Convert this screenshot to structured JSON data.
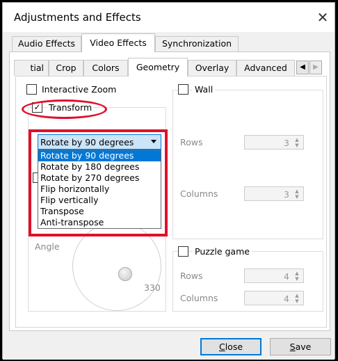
{
  "window": {
    "title": "Adjustments and Effects",
    "close_glyph": "✕"
  },
  "top_tabs": [
    {
      "label": "Audio Effects"
    },
    {
      "label": "Video Effects"
    },
    {
      "label": "Synchronization"
    }
  ],
  "sub_tabs": [
    {
      "label": "tial"
    },
    {
      "label": "Crop"
    },
    {
      "label": "Colors"
    },
    {
      "label": "Geometry"
    },
    {
      "label": "Overlay"
    },
    {
      "label": "Advanced"
    }
  ],
  "geometry": {
    "interactive_zoom": {
      "label": "Interactive Zoom",
      "checked": false
    },
    "transform": {
      "label": "Transform",
      "checked": true,
      "check_glyph": "✓"
    },
    "rotate_select": {
      "value": "Rotate by 90 degrees",
      "options": [
        "Rotate by 90 degrees",
        "Rotate by 180 degrees",
        "Rotate by 270 degrees",
        "Flip horizontally",
        "Flip vertically",
        "Transpose",
        "Anti-transpose"
      ]
    },
    "angle_label": "Angle",
    "angle_value": "330",
    "wall": {
      "label": "Wall",
      "checked": false,
      "rows_label": "Rows",
      "rows_value": "3",
      "columns_label": "Columns",
      "columns_value": "3"
    },
    "puzzle": {
      "label": "Puzzle game",
      "checked": false,
      "rows_label": "Rows",
      "rows_value": "4",
      "columns_label": "Columns",
      "columns_value": "4"
    }
  },
  "buttons": {
    "close_mnemonic": "C",
    "close_rest": "lose",
    "save_mnemonic": "S",
    "save_rest": "ave"
  },
  "annotation_color": "#e0102a"
}
